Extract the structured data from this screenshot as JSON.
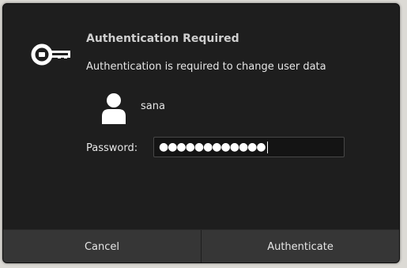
{
  "dialog": {
    "title": "Authentication Required",
    "message": "Authentication is required to change user data",
    "icon": "key-icon"
  },
  "user": {
    "name": "sana",
    "avatar_icon": "user-avatar-icon"
  },
  "password": {
    "label": "Password:",
    "masked_value": "●●●●●●●●●●●●"
  },
  "buttons": {
    "cancel_label": "Cancel",
    "authenticate_label": "Authenticate"
  },
  "colors": {
    "dialog_bg": "#1e1e1e",
    "button_bar_bg": "#363636",
    "field_bg": "#141414",
    "text": "#e6e6e6"
  }
}
